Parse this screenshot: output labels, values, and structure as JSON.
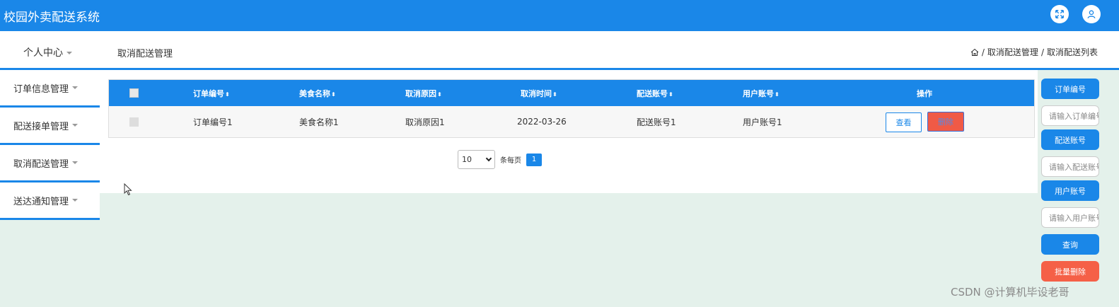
{
  "app": {
    "title": "校园外卖配送系统"
  },
  "header_icons": {
    "fullscreen": "fullscreen-icon",
    "user": "user-icon"
  },
  "subbar": {
    "personal_center": "个人中心",
    "page_title": "取消配送管理",
    "breadcrumb": [
      "取消配送管理",
      "取消配送列表"
    ],
    "breadcrumb_sep": "/"
  },
  "sidebar": {
    "items": [
      {
        "label": "订单信息管理"
      },
      {
        "label": "配送接单管理"
      },
      {
        "label": "取消配送管理"
      },
      {
        "label": "送达通知管理"
      }
    ]
  },
  "table": {
    "headers": {
      "order_no": "订单编号",
      "food_name": "美食名称",
      "cancel_reason": "取消原因",
      "cancel_time": "取消时间",
      "delivery_account": "配送账号",
      "user_account": "用户账号",
      "actions": "操作"
    },
    "sort_glyph": "⬍",
    "rows": [
      {
        "order_no": "订单编号1",
        "food_name": "美食名称1",
        "cancel_reason": "取消原因1",
        "cancel_time": "2022-03-26",
        "delivery_account": "配送账号1",
        "user_account": "用户账号1"
      }
    ],
    "view_label": "查看",
    "delete_label": "删除"
  },
  "pager": {
    "page_size": "10",
    "per_page_label": "条每页",
    "current_page": "1"
  },
  "search_panel": {
    "order_no_label": "订单编号",
    "order_no_placeholder": "请输入订单编号",
    "delivery_label": "配送账号",
    "delivery_placeholder": "请输入配送账号",
    "user_label": "用户账号",
    "user_placeholder": "请输入用户账号",
    "query_label": "查询",
    "batch_delete_label": "批量删除"
  },
  "watermark": "CSDN @计算机毕设老哥",
  "colors": {
    "primary": "#1a87e8",
    "danger": "#f56047",
    "background": "#e4f1eb"
  }
}
